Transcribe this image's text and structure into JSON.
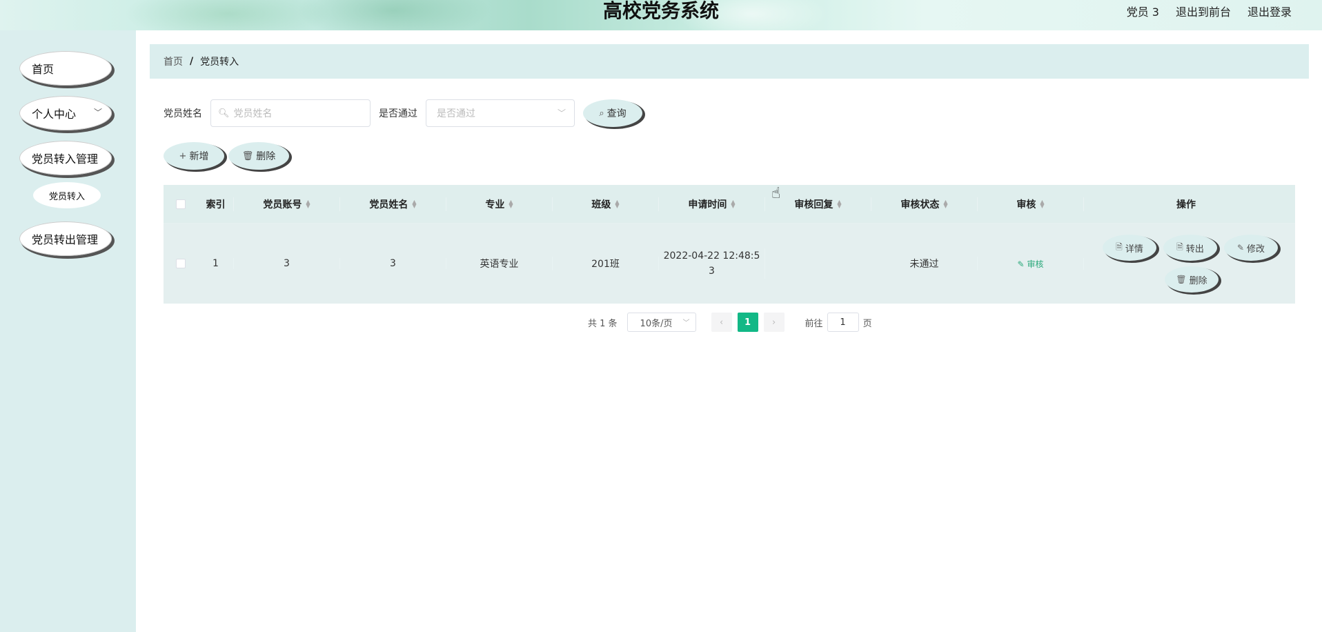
{
  "header": {
    "title": "高校党务系统",
    "user": "党员 3",
    "exit_front": "退出到前台",
    "logout": "退出登录"
  },
  "sidebar": {
    "items": [
      {
        "label": "首页"
      },
      {
        "label": "个人中心",
        "expandable": true
      },
      {
        "label": "党员转入管理"
      },
      {
        "label": "党员转入"
      },
      {
        "label": "党员转出管理"
      }
    ]
  },
  "breadcrumb": {
    "home": "首页",
    "sep": "/",
    "current": "党员转入"
  },
  "search": {
    "name_label": "党员姓名",
    "name_placeholder": "党员姓名",
    "pass_label": "是否通过",
    "pass_placeholder": "是否通过",
    "query_label": "查询"
  },
  "actions": {
    "add_label": "新增",
    "delete_label": "删除"
  },
  "table": {
    "columns": [
      "索引",
      "党员账号",
      "党员姓名",
      "专业",
      "班级",
      "申请时间",
      "审核回复",
      "审核状态",
      "审核",
      "操作"
    ],
    "rows": [
      {
        "index": "1",
        "account": "3",
        "name": "3",
        "major": "英语专业",
        "class": "201班",
        "apply_time_line1": "2022-04-22 12:48:5",
        "apply_time_line2": "3",
        "reply": "",
        "status": "未通过",
        "audit_label": "审核",
        "ops": {
          "detail": "详情",
          "transfer": "转出",
          "edit": "修改",
          "delete": "删除"
        }
      }
    ]
  },
  "pagination": {
    "total": "共 1 条",
    "page_size": "10条/页",
    "current": "1",
    "goto_label": "前往",
    "goto_value": "1",
    "page_suffix": "页"
  },
  "colors": {
    "accent": "#12b886",
    "panel": "#dbeeee",
    "audit_link": "#2aa87a"
  }
}
